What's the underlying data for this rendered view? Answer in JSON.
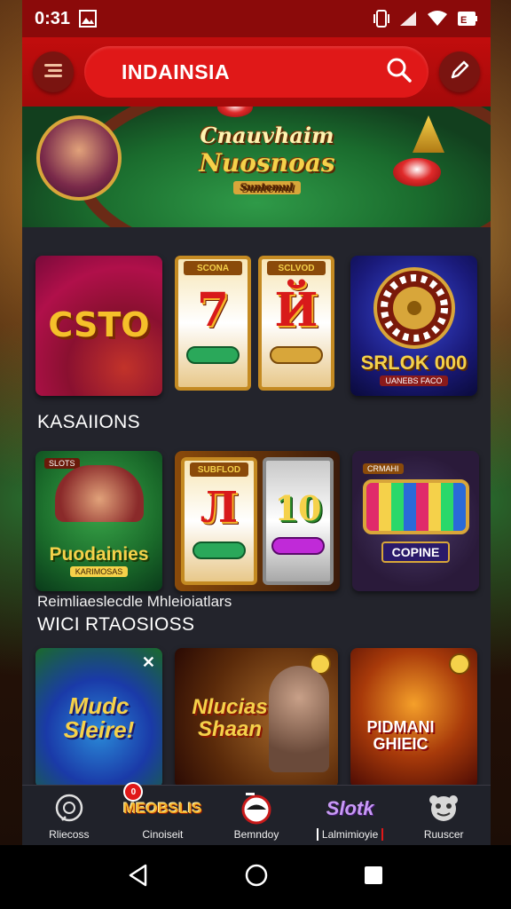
{
  "status_bar": {
    "time": "0:31",
    "icons": [
      "gallery-icon",
      "vibrate-icon",
      "signal-icon",
      "wifi-icon",
      "battery-icon"
    ]
  },
  "header": {
    "menu_icon": "hamburger-icon",
    "search_text": "INDAINSIA",
    "search_icon": "search-icon",
    "edit_icon": "pencil-icon"
  },
  "banner": {
    "title_line1": "Cnauvhaim",
    "title_line2": "Nuosnoas",
    "title_line3": "Suntemul"
  },
  "row1": {
    "tiles": [
      {
        "label": "CSTO"
      },
      {
        "top": "SCONA",
        "number": "7"
      },
      {
        "top": "SCLVOD",
        "number": "Й"
      },
      {
        "label": "SRLOK 000",
        "sub": "UANEBS FACO"
      }
    ]
  },
  "section1": {
    "title": "KASAIIONS"
  },
  "row2": {
    "tiles": [
      {
        "top": "SLOTS",
        "label": "Puodainies",
        "sub": "KARIMOSAS"
      },
      {
        "top": "SUBFLOD",
        "number": "Л",
        "number2": "10"
      },
      {
        "top": "CRMAHI",
        "label": "COPINE"
      }
    ]
  },
  "section2": {
    "subtitle": "Reimliaeslecdle Mhleioiatlars",
    "title": "WICI  RTAOSIOSS"
  },
  "row3": {
    "tiles": [
      {
        "label": "Mudc Sleire!"
      },
      {
        "label": "Nlucias Shaan"
      },
      {
        "label": "PIDMANI GHIEIC"
      }
    ]
  },
  "bottom_nav": {
    "items": [
      {
        "label": "Rliecoss",
        "icon": "chat-icon"
      },
      {
        "label": "Cinoiseit",
        "icon": "logo-icon",
        "logo_text": "MEOBSLIS"
      },
      {
        "label": "Bemndoy",
        "icon": "brand-icon"
      },
      {
        "label": "Lalmimioyie",
        "icon": "slot-logo-icon",
        "logo_text": "Slotk"
      },
      {
        "label": "Ruuscer",
        "icon": "mascot-icon"
      }
    ],
    "badge_count": "0"
  },
  "system_nav": {
    "back_icon": "back-triangle-icon",
    "home_icon": "home-circle-icon",
    "recents_icon": "recents-square-icon"
  },
  "colors": {
    "header_red": "#c20d0d",
    "search_red": "#e01818",
    "content_bg": "#23242c",
    "gold": "#f5d14a"
  }
}
